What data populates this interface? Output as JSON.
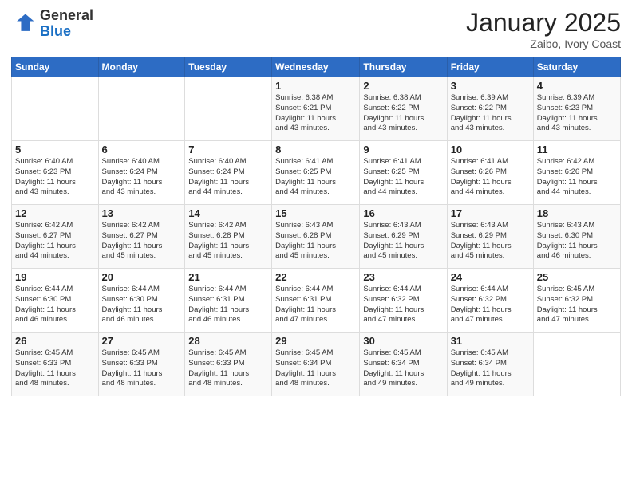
{
  "logo": {
    "general": "General",
    "blue": "Blue"
  },
  "header": {
    "month": "January 2025",
    "location": "Zaibo, Ivory Coast"
  },
  "days_of_week": [
    "Sunday",
    "Monday",
    "Tuesday",
    "Wednesday",
    "Thursday",
    "Friday",
    "Saturday"
  ],
  "weeks": [
    [
      {
        "day": "",
        "info": ""
      },
      {
        "day": "",
        "info": ""
      },
      {
        "day": "",
        "info": ""
      },
      {
        "day": "1",
        "info": "Sunrise: 6:38 AM\nSunset: 6:21 PM\nDaylight: 11 hours\nand 43 minutes."
      },
      {
        "day": "2",
        "info": "Sunrise: 6:38 AM\nSunset: 6:22 PM\nDaylight: 11 hours\nand 43 minutes."
      },
      {
        "day": "3",
        "info": "Sunrise: 6:39 AM\nSunset: 6:22 PM\nDaylight: 11 hours\nand 43 minutes."
      },
      {
        "day": "4",
        "info": "Sunrise: 6:39 AM\nSunset: 6:23 PM\nDaylight: 11 hours\nand 43 minutes."
      }
    ],
    [
      {
        "day": "5",
        "info": "Sunrise: 6:40 AM\nSunset: 6:23 PM\nDaylight: 11 hours\nand 43 minutes."
      },
      {
        "day": "6",
        "info": "Sunrise: 6:40 AM\nSunset: 6:24 PM\nDaylight: 11 hours\nand 43 minutes."
      },
      {
        "day": "7",
        "info": "Sunrise: 6:40 AM\nSunset: 6:24 PM\nDaylight: 11 hours\nand 44 minutes."
      },
      {
        "day": "8",
        "info": "Sunrise: 6:41 AM\nSunset: 6:25 PM\nDaylight: 11 hours\nand 44 minutes."
      },
      {
        "day": "9",
        "info": "Sunrise: 6:41 AM\nSunset: 6:25 PM\nDaylight: 11 hours\nand 44 minutes."
      },
      {
        "day": "10",
        "info": "Sunrise: 6:41 AM\nSunset: 6:26 PM\nDaylight: 11 hours\nand 44 minutes."
      },
      {
        "day": "11",
        "info": "Sunrise: 6:42 AM\nSunset: 6:26 PM\nDaylight: 11 hours\nand 44 minutes."
      }
    ],
    [
      {
        "day": "12",
        "info": "Sunrise: 6:42 AM\nSunset: 6:27 PM\nDaylight: 11 hours\nand 44 minutes."
      },
      {
        "day": "13",
        "info": "Sunrise: 6:42 AM\nSunset: 6:27 PM\nDaylight: 11 hours\nand 45 minutes."
      },
      {
        "day": "14",
        "info": "Sunrise: 6:42 AM\nSunset: 6:28 PM\nDaylight: 11 hours\nand 45 minutes."
      },
      {
        "day": "15",
        "info": "Sunrise: 6:43 AM\nSunset: 6:28 PM\nDaylight: 11 hours\nand 45 minutes."
      },
      {
        "day": "16",
        "info": "Sunrise: 6:43 AM\nSunset: 6:29 PM\nDaylight: 11 hours\nand 45 minutes."
      },
      {
        "day": "17",
        "info": "Sunrise: 6:43 AM\nSunset: 6:29 PM\nDaylight: 11 hours\nand 45 minutes."
      },
      {
        "day": "18",
        "info": "Sunrise: 6:43 AM\nSunset: 6:30 PM\nDaylight: 11 hours\nand 46 minutes."
      }
    ],
    [
      {
        "day": "19",
        "info": "Sunrise: 6:44 AM\nSunset: 6:30 PM\nDaylight: 11 hours\nand 46 minutes."
      },
      {
        "day": "20",
        "info": "Sunrise: 6:44 AM\nSunset: 6:30 PM\nDaylight: 11 hours\nand 46 minutes."
      },
      {
        "day": "21",
        "info": "Sunrise: 6:44 AM\nSunset: 6:31 PM\nDaylight: 11 hours\nand 46 minutes."
      },
      {
        "day": "22",
        "info": "Sunrise: 6:44 AM\nSunset: 6:31 PM\nDaylight: 11 hours\nand 47 minutes."
      },
      {
        "day": "23",
        "info": "Sunrise: 6:44 AM\nSunset: 6:32 PM\nDaylight: 11 hours\nand 47 minutes."
      },
      {
        "day": "24",
        "info": "Sunrise: 6:44 AM\nSunset: 6:32 PM\nDaylight: 11 hours\nand 47 minutes."
      },
      {
        "day": "25",
        "info": "Sunrise: 6:45 AM\nSunset: 6:32 PM\nDaylight: 11 hours\nand 47 minutes."
      }
    ],
    [
      {
        "day": "26",
        "info": "Sunrise: 6:45 AM\nSunset: 6:33 PM\nDaylight: 11 hours\nand 48 minutes."
      },
      {
        "day": "27",
        "info": "Sunrise: 6:45 AM\nSunset: 6:33 PM\nDaylight: 11 hours\nand 48 minutes."
      },
      {
        "day": "28",
        "info": "Sunrise: 6:45 AM\nSunset: 6:33 PM\nDaylight: 11 hours\nand 48 minutes."
      },
      {
        "day": "29",
        "info": "Sunrise: 6:45 AM\nSunset: 6:34 PM\nDaylight: 11 hours\nand 48 minutes."
      },
      {
        "day": "30",
        "info": "Sunrise: 6:45 AM\nSunset: 6:34 PM\nDaylight: 11 hours\nand 49 minutes."
      },
      {
        "day": "31",
        "info": "Sunrise: 6:45 AM\nSunset: 6:34 PM\nDaylight: 11 hours\nand 49 minutes."
      },
      {
        "day": "",
        "info": ""
      }
    ]
  ]
}
